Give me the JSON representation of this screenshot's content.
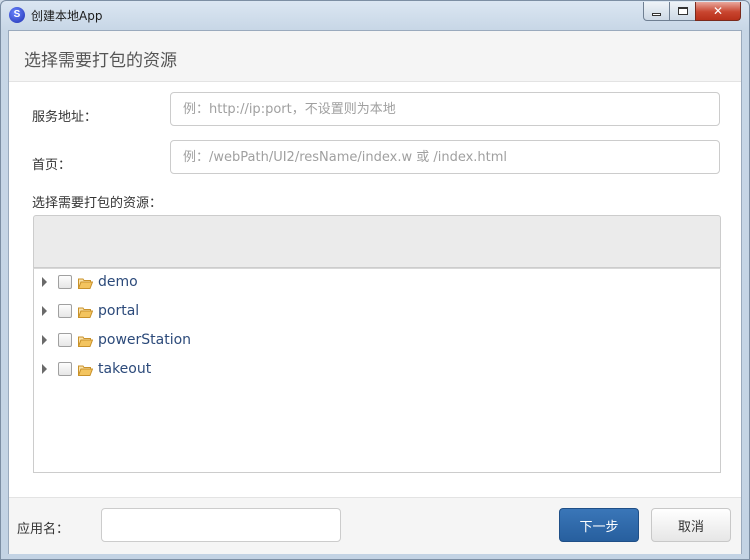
{
  "window": {
    "title": "创建本地App",
    "controls": {
      "minimize": "minimize",
      "maximize": "maximize",
      "close": "✕"
    }
  },
  "header": {
    "title": "选择需要打包的资源"
  },
  "form": {
    "server_label": "服务地址：",
    "server_placeholder": "例：http://ip:port，不设置则为本地",
    "server_value": "",
    "home_label": "首页：",
    "home_placeholder": "例：/webPath/UI2/resName/index.w 或 /index.html",
    "home_value": "",
    "resources_label": "选择需要打包的资源："
  },
  "tree": {
    "items": [
      {
        "label": "demo",
        "checked": false,
        "expanded": false
      },
      {
        "label": "portal",
        "checked": false,
        "expanded": false
      },
      {
        "label": "powerStation",
        "checked": false,
        "expanded": false
      },
      {
        "label": "takeout",
        "checked": false,
        "expanded": false
      }
    ]
  },
  "footer": {
    "app_name_label": "应用名：",
    "app_name_value": "",
    "next_label": "下一步",
    "cancel_label": "取消"
  },
  "colors": {
    "primary_button": "#2d67a8",
    "folder": "#e8a83a",
    "tree_text": "#2c4a7a"
  }
}
